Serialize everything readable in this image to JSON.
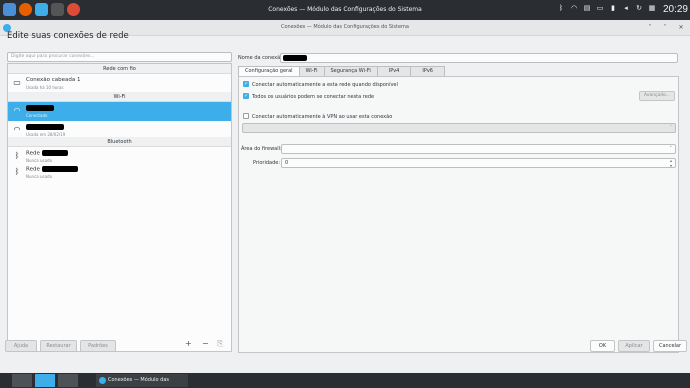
{
  "topbar": {
    "title": "Conexões — Módulo das Configurações do Sistema",
    "clock": "20:29",
    "tray_icons": [
      "bluetooth-icon",
      "network-icon",
      "clipboard-icon",
      "monitor-icon",
      "battery-icon",
      "volume-icon",
      "updates-icon",
      "keyboard-icon"
    ],
    "launcher_icons": [
      "kde-menu-icon",
      "firefox-icon",
      "files-icon",
      "terminal-icon",
      "chrome-icon"
    ]
  },
  "window": {
    "title": "Conexões — Módulo das Configurações do Sistema"
  },
  "page_title": "Edite suas conexões de rede",
  "search": {
    "placeholder": "Digite aqui para procurar conexões..."
  },
  "sections": {
    "wired": "Rede com fio",
    "wifi": "Wi-Fi",
    "bluetooth": "Bluetooth"
  },
  "connections": {
    "wired": [
      {
        "name": "Conexão cabeada 1",
        "sub": "Usada há 10 horas"
      }
    ],
    "wifi": [
      {
        "name": "",
        "sub": "Conectado",
        "selected": true
      },
      {
        "name": "",
        "sub": "Usada em 28/02/19"
      }
    ],
    "bluetooth": [
      {
        "name": "Rede",
        "sub": "Nunca usado"
      },
      {
        "name": "Rede",
        "sub": "Nunca usado"
      }
    ]
  },
  "list_tools": {
    "add": "+",
    "remove": "−",
    "export": "⎘"
  },
  "form": {
    "name_label": "Nome da conexão:",
    "tabs": [
      "Configuração geral",
      "Wi-Fi",
      "Segurança Wi-Fi",
      "IPv4",
      "IPv6"
    ],
    "active_tab": 0,
    "auto_connect": "Conectar automaticamente a esta rede quando disponível",
    "all_users": "Todos os usuários podem se conectar nesta rede",
    "advanced": "Avançado...",
    "vpn": "Conectar automaticamente à VPN ao usar esta conexão",
    "firewall_label": "Área do firewall:",
    "priority_label": "Prioridade:",
    "priority_value": "0"
  },
  "bottom": {
    "help": "Ajuda",
    "reset": "Restaurar",
    "defaults": "Padrões",
    "ok": "OK",
    "apply": "Aplicar",
    "cancel": "Cancelar"
  },
  "taskbar": {
    "app_label": "Conexões — Módulo das Configur..."
  }
}
